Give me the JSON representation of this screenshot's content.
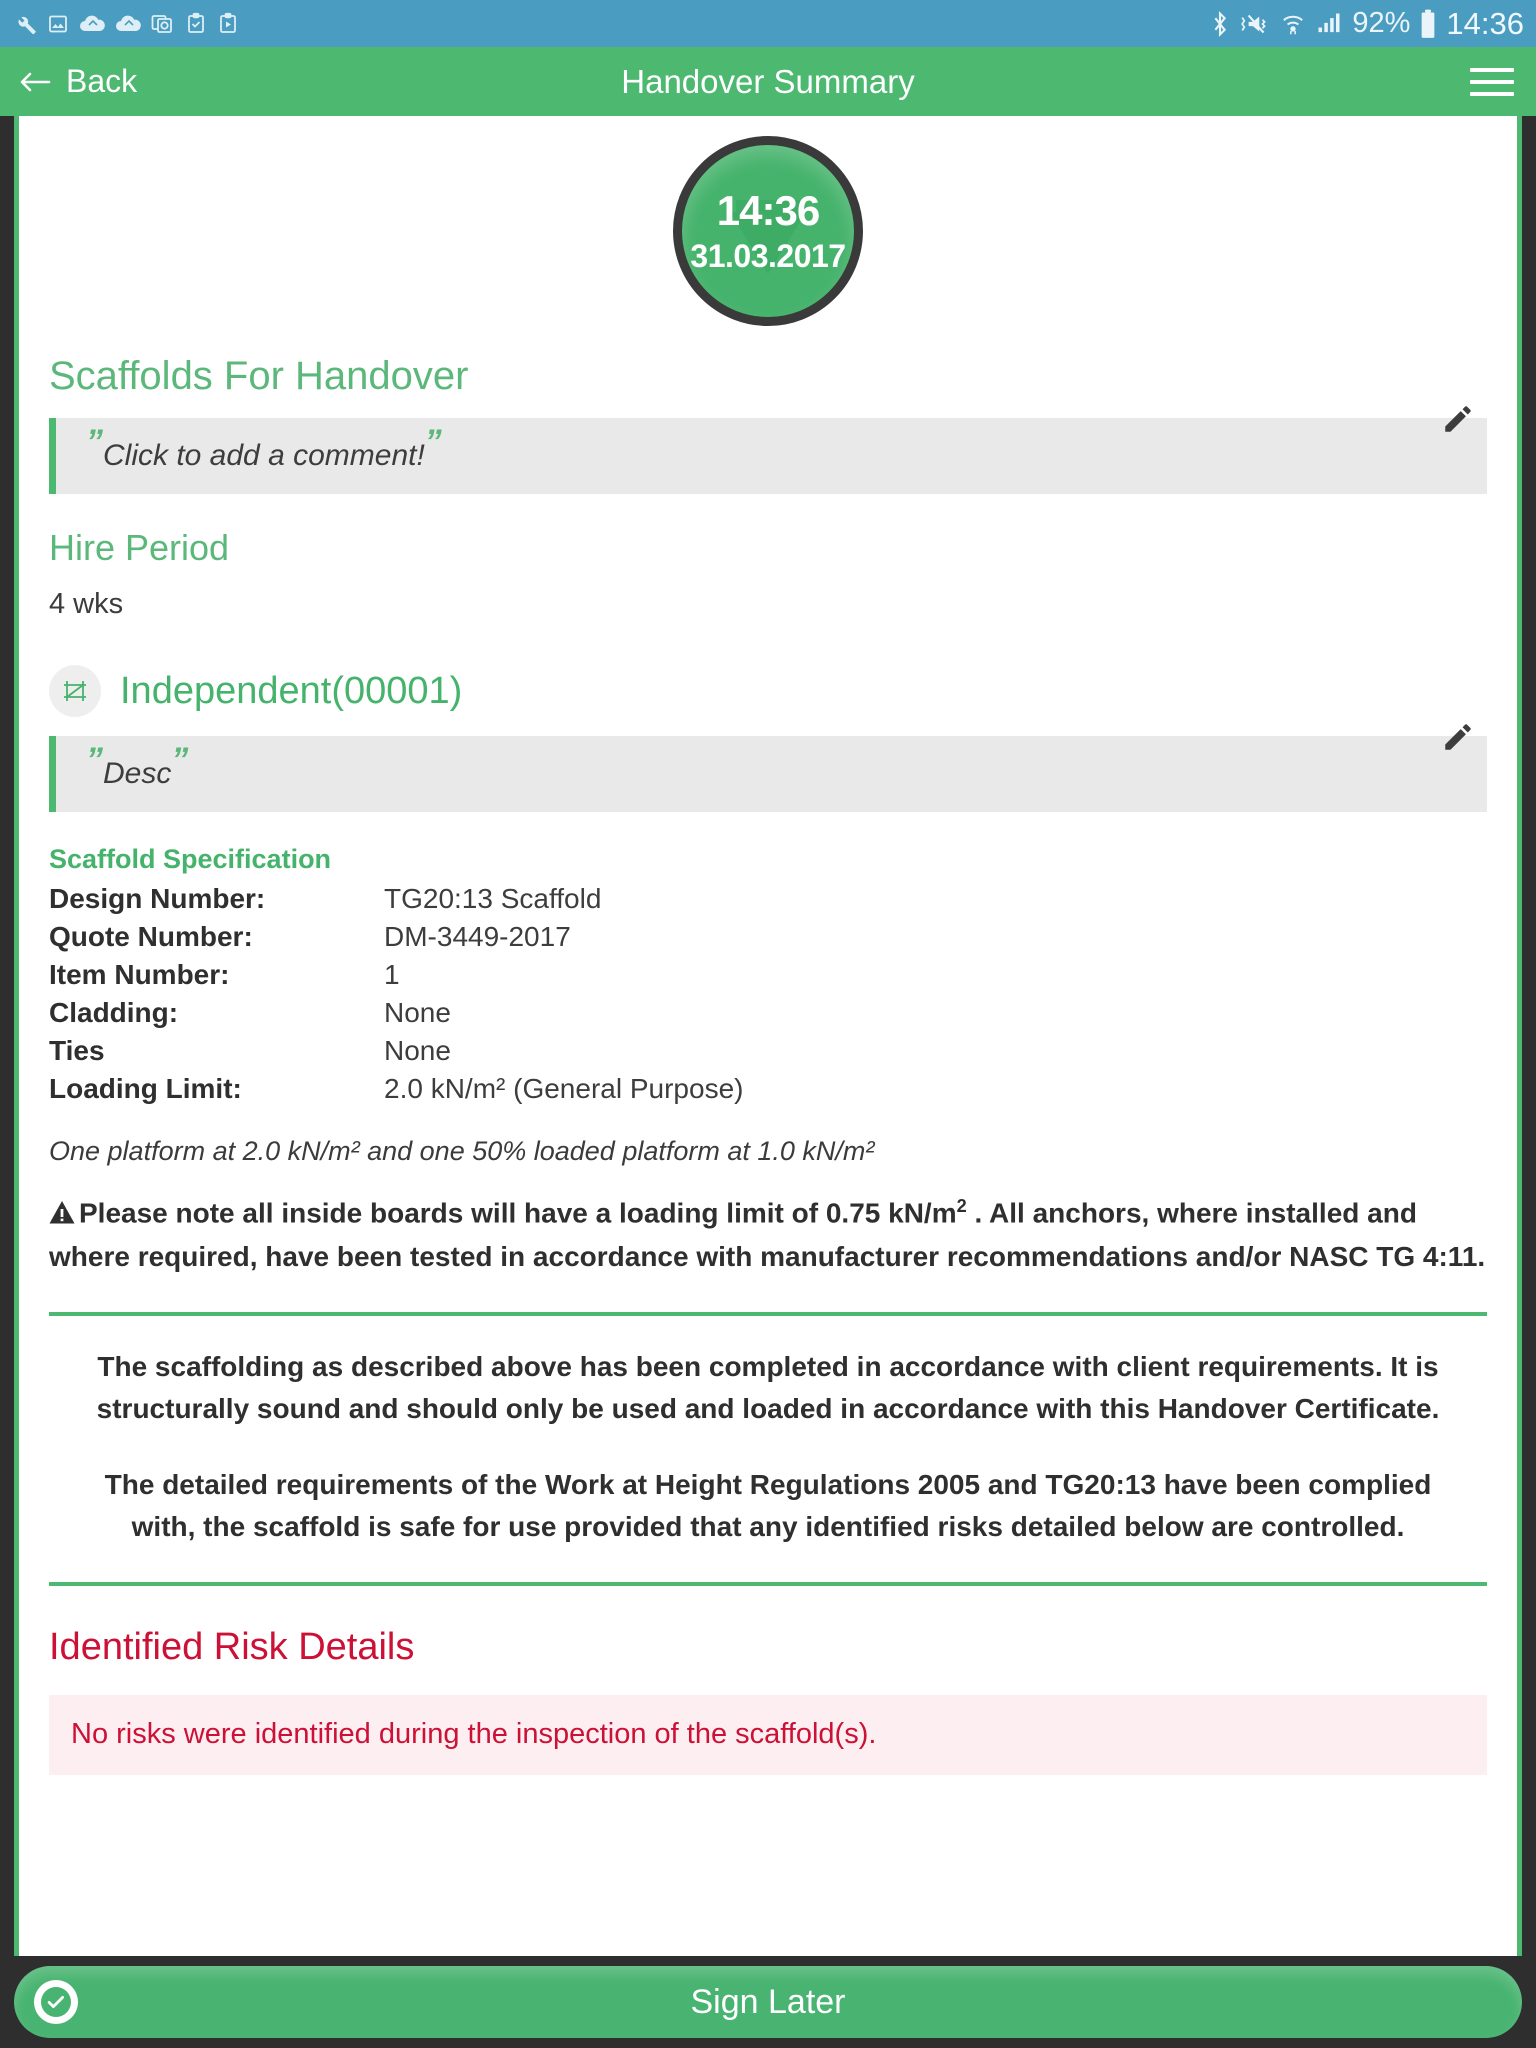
{
  "statusbar": {
    "icons_left": [
      "wrench-icon",
      "image-icon",
      "cloud-upload-icon",
      "cloud-sync-icon",
      "mail-gallery-icon",
      "clipboard-check-icon",
      "clipboard-play-icon"
    ],
    "icons_right": [
      "bluetooth-icon",
      "mute-icon",
      "wifi-icon",
      "signal-icon"
    ],
    "battery_percent": "92%",
    "battery_icon": "battery-icon",
    "time": "14:36"
  },
  "appbar": {
    "back_label": "Back",
    "back_icon": "arrow-left-icon",
    "title": "Handover Summary",
    "menu_icon": "hamburger-menu-icon"
  },
  "badge": {
    "time": "14:36",
    "date": "31.03.2017",
    "watermark_icon": "check-badge-icon"
  },
  "scaffolds_section": {
    "heading": "Scaffolds For Handover",
    "comment_placeholder": "Click to add a comment!",
    "quote_open": "”",
    "quote_close": "”",
    "edit_icon": "pencil-edit-icon"
  },
  "hire_period": {
    "label": "Hire Period",
    "value": "4 wks"
  },
  "scaffold": {
    "icon": "scaffold-frame-icon",
    "name": "Independent(00001)",
    "description": "Desc",
    "edit_icon": "pencil-edit-icon"
  },
  "specification": {
    "title": "Scaffold Specification",
    "rows": [
      {
        "label": "Design Number:",
        "value": "TG20:13 Scaffold"
      },
      {
        "label": "Quote Number:",
        "value": "DM-3449-2017"
      },
      {
        "label": "Item Number:",
        "value": "1"
      },
      {
        "label": "Cladding:",
        "value": "None"
      },
      {
        "label": "Ties",
        "value": "None"
      },
      {
        "label": "Loading Limit:",
        "value": "2.0 kN/m² (General Purpose)"
      }
    ],
    "note": "One platform at 2.0 kN/m² and one 50% loaded platform at 1.0 kN/m²",
    "warning_icon": "warning-triangle-icon",
    "warning_part1": "Please note all inside boards will have a loading limit of 0.75 kN/m",
    "warning_sup": "2",
    "warning_part2": " . All anchors, where installed and where required, have been tested in accordance with manufacturer recommendations and/or NASC TG 4:11."
  },
  "declaration": {
    "paragraph1": "The scaffolding as described above has been completed in accordance with client requirements. It is structurally sound and should only be used and loaded in accordance with this Handover Certificate.",
    "paragraph2": "The detailed requirements of the Work at Height Regulations 2005 and TG20:13 have been complied with, the scaffold is safe for use provided that any identified risks detailed below are controlled."
  },
  "risks": {
    "title": "Identified Risk Details",
    "message": "No risks were identified during the inspection of the scaffold(s)."
  },
  "bottom": {
    "sign_later_label": "Sign Later",
    "check_icon": "check-circle-icon"
  },
  "colors": {
    "status_bar": "#4a9dc0",
    "app_bar": "#4cb870",
    "accent_green": "#4cb870",
    "heading_green": "#5cb87a",
    "risk_red": "#cc1036",
    "risk_bg": "#fdeff1",
    "comment_bg": "#e9e9e9",
    "chrome_dark": "#2e2e2e"
  }
}
